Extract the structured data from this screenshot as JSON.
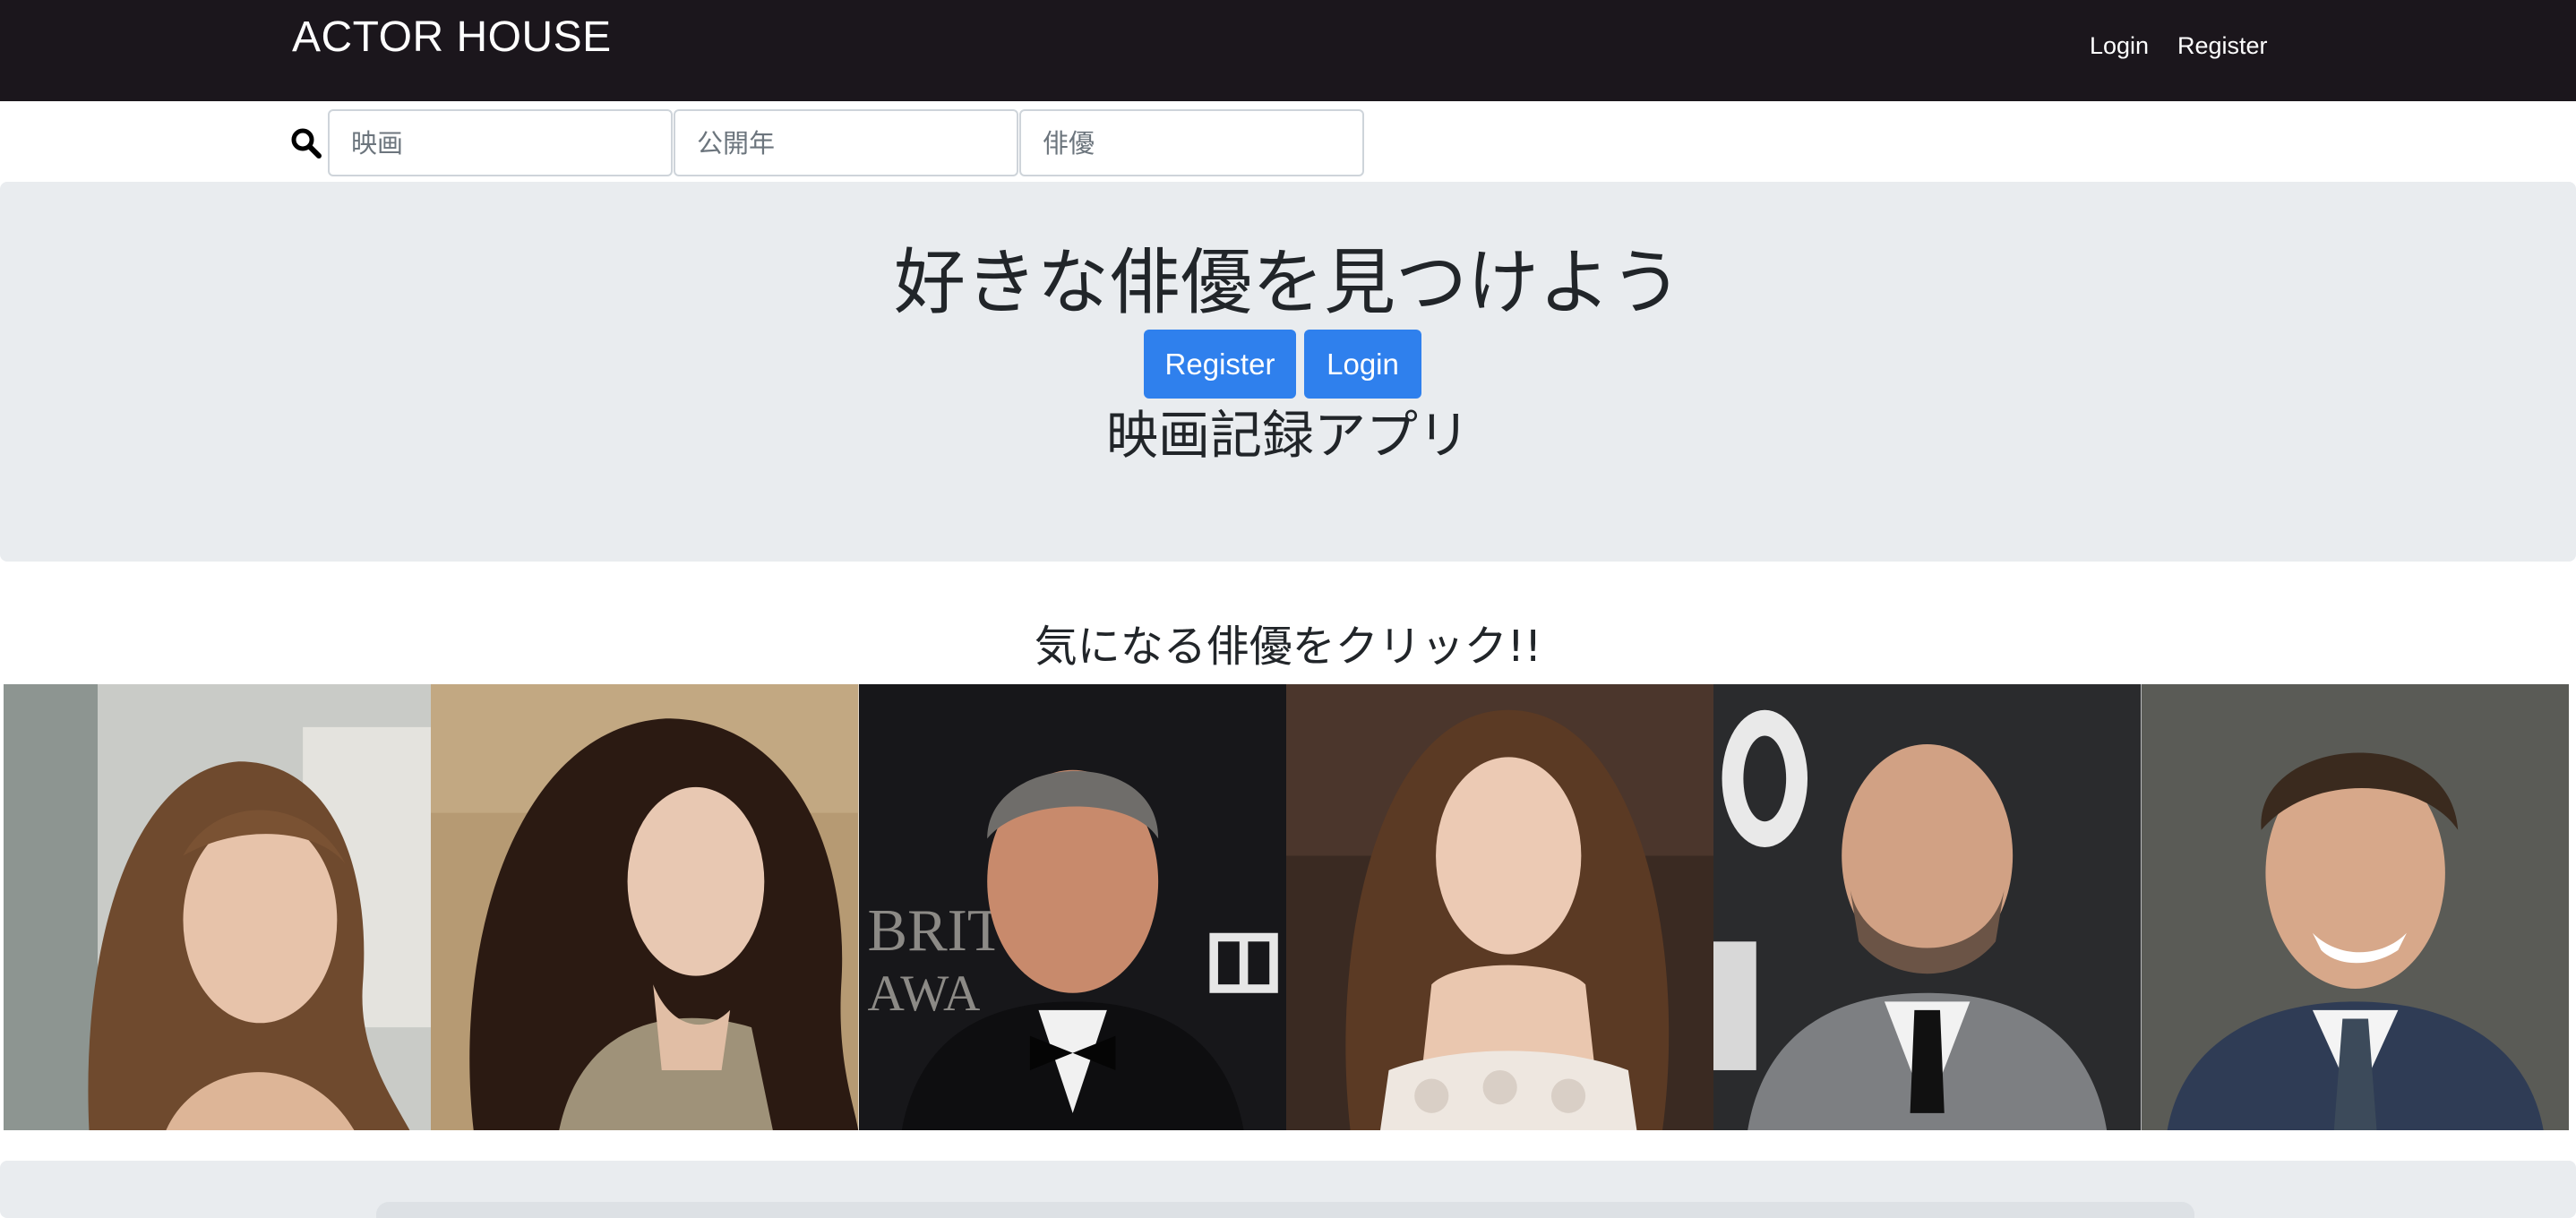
{
  "navbar": {
    "brand": "ACTOR HOUSE",
    "links": {
      "login": "Login",
      "register": "Register"
    }
  },
  "search": {
    "icon": "search-icon",
    "fields": {
      "movie_placeholder": "映画",
      "year_placeholder": "公開年",
      "actor_placeholder": "俳優"
    }
  },
  "hero": {
    "title": "好きな俳優を見つけよう",
    "register_button": "Register",
    "login_button": "Login",
    "subtitle": "映画記録アプリ"
  },
  "actors_section": {
    "title": "気になる俳優をクリック!!",
    "actors": [
      {
        "photo": "actor-photo-1"
      },
      {
        "photo": "actor-photo-2"
      },
      {
        "photo": "actor-photo-3"
      },
      {
        "photo": "actor-photo-4"
      },
      {
        "photo": "actor-photo-5"
      },
      {
        "photo": "actor-photo-6"
      }
    ]
  },
  "colors": {
    "navbar_bg": "#1b161c",
    "jumbotron_bg": "#e9ecef",
    "button_primary": "#2f80ed"
  }
}
